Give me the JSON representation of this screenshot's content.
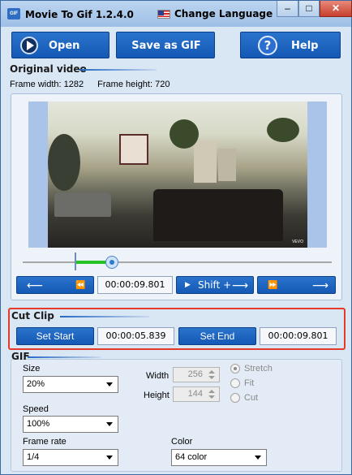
{
  "window": {
    "app_icon_text": "GIF",
    "title": "Movie To Gif 1.2.4.0",
    "language_label": "Change Language",
    "minimize_glyph": "–",
    "maximize_glyph": "□",
    "close_glyph": "✕"
  },
  "toolbar": {
    "open_label": "Open",
    "save_as_gif_label": "Save as GIF",
    "help_label": "Help",
    "help_glyph": "?"
  },
  "original_video": {
    "title": "Original video",
    "frame_width_label": "Frame width: 1282",
    "frame_height_label": "Frame height: 720",
    "current_time": "00:00:09.801",
    "shift_label": "Shift +",
    "video_badge": "VEVO"
  },
  "cut_clip": {
    "title": "Cut Clip",
    "set_start_label": "Set Start",
    "start_time": "00:00:05.839",
    "set_end_label": "Set End",
    "end_time": "00:00:09.801"
  },
  "gif": {
    "title": "GIF",
    "size_label": "Size",
    "size_value": "20%",
    "speed_label": "Speed",
    "speed_value": "100%",
    "frame_rate_label": "Frame rate",
    "frame_rate_value": "1/4",
    "width_label": "Width",
    "width_value": "256",
    "height_label": "Height",
    "height_value": "144",
    "stretch_label": "Stretch",
    "fit_label": "Fit",
    "cut_label": "Cut",
    "color_label": "Color",
    "color_value": "64 color"
  },
  "icons": {
    "left_arrow": "⟵",
    "right_arrow": "⟶",
    "rewind": "⏪",
    "fast_forward": "⏩",
    "play": "▶"
  },
  "colors": {
    "button_blue": "#1459b5",
    "selection_green": "#22c322",
    "highlight_red": "#e53a2a"
  }
}
